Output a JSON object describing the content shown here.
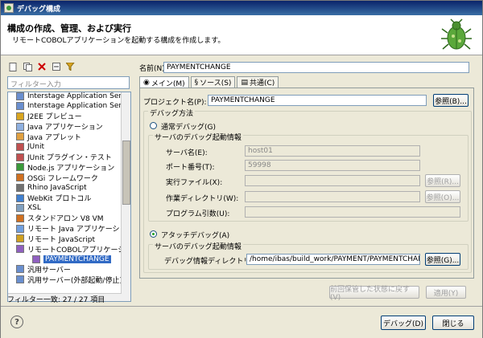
{
  "window": {
    "title": "デバッグ構成"
  },
  "header": {
    "title": "構成の作成、管理、および実行",
    "subtitle": "リモートCOBOLアプリケーションを起動する構成を作成します。"
  },
  "toolbar": {
    "icons": [
      "new-config-icon",
      "duplicate-icon",
      "delete-icon",
      "collapse-icon",
      "filter-icon"
    ]
  },
  "filter": {
    "placeholder": "フィルター入力"
  },
  "tree": {
    "items": [
      {
        "label": "Interstage Application Serve",
        "icon": "server-icon"
      },
      {
        "label": "Interstage Application Serve",
        "icon": "server-icon"
      },
      {
        "label": "J2EE プレビュー",
        "icon": "j2ee-icon"
      },
      {
        "label": "Java アプリケーション",
        "icon": "java-app-icon"
      },
      {
        "label": "Java アプレット",
        "icon": "applet-icon"
      },
      {
        "label": "JUnit",
        "icon": "junit-icon"
      },
      {
        "label": "JUnit プラグイン・テスト",
        "icon": "junit-plugin-icon"
      },
      {
        "label": "Node.js アプリケーション",
        "icon": "nodejs-icon"
      },
      {
        "label": "OSGi フレームワーク",
        "icon": "osgi-icon"
      },
      {
        "label": "Rhino JavaScript",
        "icon": "rhino-icon"
      },
      {
        "label": "WebKit プロトコル",
        "icon": "webkit-icon"
      },
      {
        "label": "XSL",
        "icon": "xsl-icon"
      },
      {
        "label": "スタンドアロン V8 VM",
        "icon": "v8-icon"
      },
      {
        "label": "リモート Java アプリケーション",
        "icon": "remote-java-icon"
      },
      {
        "label": "リモート JavaScript",
        "icon": "remote-js-icon"
      },
      {
        "label": "リモートCOBOLアプリケーション",
        "icon": "cobol-icon"
      },
      {
        "label": "PAYMENTCHANGE",
        "icon": "config-icon",
        "selected": true
      },
      {
        "label": "汎用サーバー",
        "icon": "server-icon"
      },
      {
        "label": "汎用サーバー(外部起動/停止)",
        "icon": "server-icon"
      }
    ]
  },
  "status": {
    "text": "フィルター一致: 27 / 27 項目"
  },
  "form": {
    "name_label": "名前(N):",
    "name_value": "PAYMENTCHANGE",
    "tabs": [
      {
        "label": "メイン(M)",
        "icon": "main-tab-icon"
      },
      {
        "label": "ソース(S)",
        "icon": "source-tab-icon"
      },
      {
        "label": "共通(C)",
        "icon": "common-tab-icon"
      }
    ],
    "project_label": "プロジェクト名(P):",
    "project_value": "PAYMENTCHANGE",
    "browse_label": "参照(B)...",
    "debug_method_label": "デバッグ方法",
    "normal_debug_label": "通常デバッグ(G)",
    "server_group_label": "サーバのデバッグ起動情報",
    "server_name_label": "サーバ名(E):",
    "server_name_value": "host01",
    "port_label": "ポート番号(T):",
    "port_value": "59998",
    "exec_file_label": "実行ファイル(X):",
    "exec_browse_label": "参照(R)...",
    "work_dir_label": "作業ディレクトリ(W):",
    "work_browse_label": "参照(O)...",
    "args_label": "プログラム引数(U):",
    "attach_debug_label": "アタッチデバッグ(A)",
    "attach_group_label": "サーバのデバッグ起動情報",
    "debug_dir_label": "デバッグ情報ディレクトリ(F):",
    "debug_dir_value": "/home/ibas/build_work/PAYMENT/PAYMENTCHANGE",
    "debug_browse_label": "参照(G)...",
    "revert_label": "前回保管した状態に戻す(V)",
    "apply_label": "適用(Y)"
  },
  "footer": {
    "debug_label": "デバッグ(D)",
    "close_label": "閉じる"
  }
}
